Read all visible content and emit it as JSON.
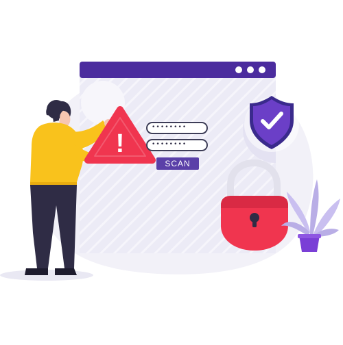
{
  "login_form": {
    "password_value_1": "••••••••",
    "password_value_2": "••••••••",
    "scan_label": "SCAN"
  },
  "warning": {
    "glyph": "!"
  },
  "icons": [
    "warning-icon",
    "shield-check-icon",
    "padlock-icon",
    "window-dots-icon"
  ],
  "colors": {
    "window_bar": "#4b2c9e",
    "window_bg": "#ecebf6",
    "warning_red": "#f0354f",
    "lock_red": "#f0354f",
    "shield_purple": "#6b3fc7",
    "sweater_yellow": "#f9c21c",
    "pants_navy": "#2f2c45",
    "plant_lilac": "#b9aee6",
    "scan_button": "#5a40a8"
  }
}
